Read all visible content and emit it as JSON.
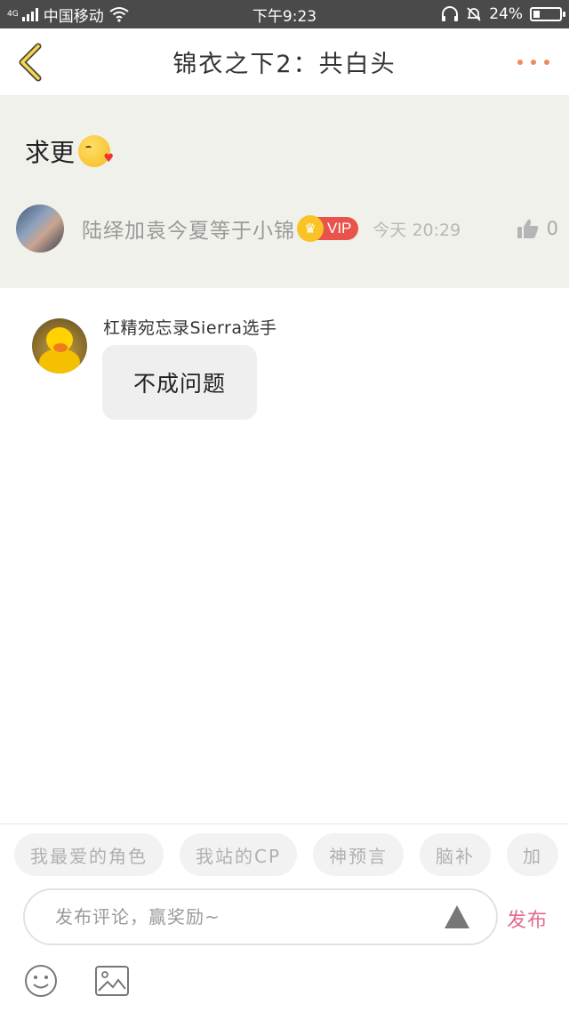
{
  "status_bar": {
    "network_type": "4G",
    "carrier": "中国移动",
    "time": "下午9:23",
    "battery_percent": "24%",
    "battery_level": 0.24
  },
  "nav": {
    "title": "锦衣之下2：共白头"
  },
  "original_comment": {
    "text": "求更",
    "author": "陆绎加袁今夏等于小锦",
    "vip_label": "VIP",
    "time": "今天 20:29",
    "like_count": "0"
  },
  "replies": [
    {
      "author": "杠精宛忘录Sierra选手",
      "text": "不成问题"
    }
  ],
  "quick_tags": [
    "我最爱的角色",
    "我站的CP",
    "神预言",
    "脑补",
    "加"
  ],
  "composer": {
    "placeholder": "发布评论，赢奖励~",
    "publish_label": "发布"
  },
  "colors": {
    "accent_orange": "#f08a5d",
    "publish_pink": "#e46b8a",
    "vip_red": "#e8534c",
    "origin_block_bg": "#eff1ea"
  },
  "icons": [
    "back-icon",
    "more-icon",
    "like-icon",
    "send-icon",
    "emoji-icon",
    "image-icon",
    "wifi-icon",
    "headset-icon",
    "mute-icon"
  ]
}
